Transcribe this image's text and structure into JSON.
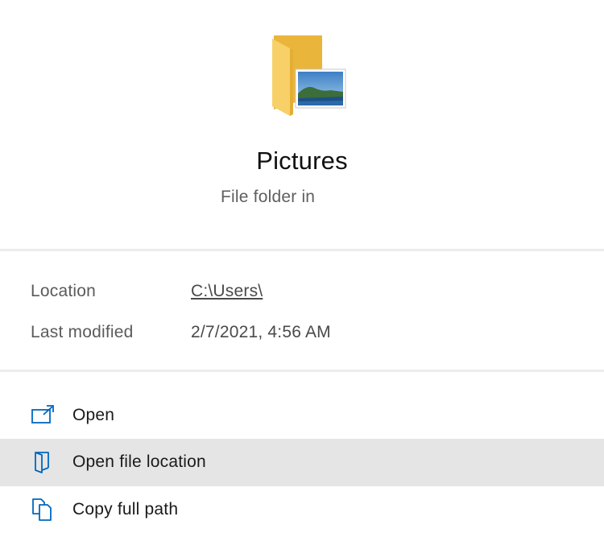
{
  "header": {
    "icon": "folder-pictures-icon",
    "title": "Pictures",
    "subtitle": "File folder in"
  },
  "details": [
    {
      "label": "Location",
      "value": "C:\\Users\\"
    },
    {
      "label": "Last modified",
      "value": "2/7/2021, 4:56 AM"
    }
  ],
  "actions": [
    {
      "label": "Open",
      "icon": "open-external-icon"
    },
    {
      "label": "Open file location",
      "icon": "open-folder-location-icon"
    },
    {
      "label": "Copy full path",
      "icon": "copy-icon"
    }
  ],
  "colors": {
    "accent": "#0067c0",
    "hover_bg": "#e5e5e5",
    "folder_yellow": "#f5c84c"
  }
}
